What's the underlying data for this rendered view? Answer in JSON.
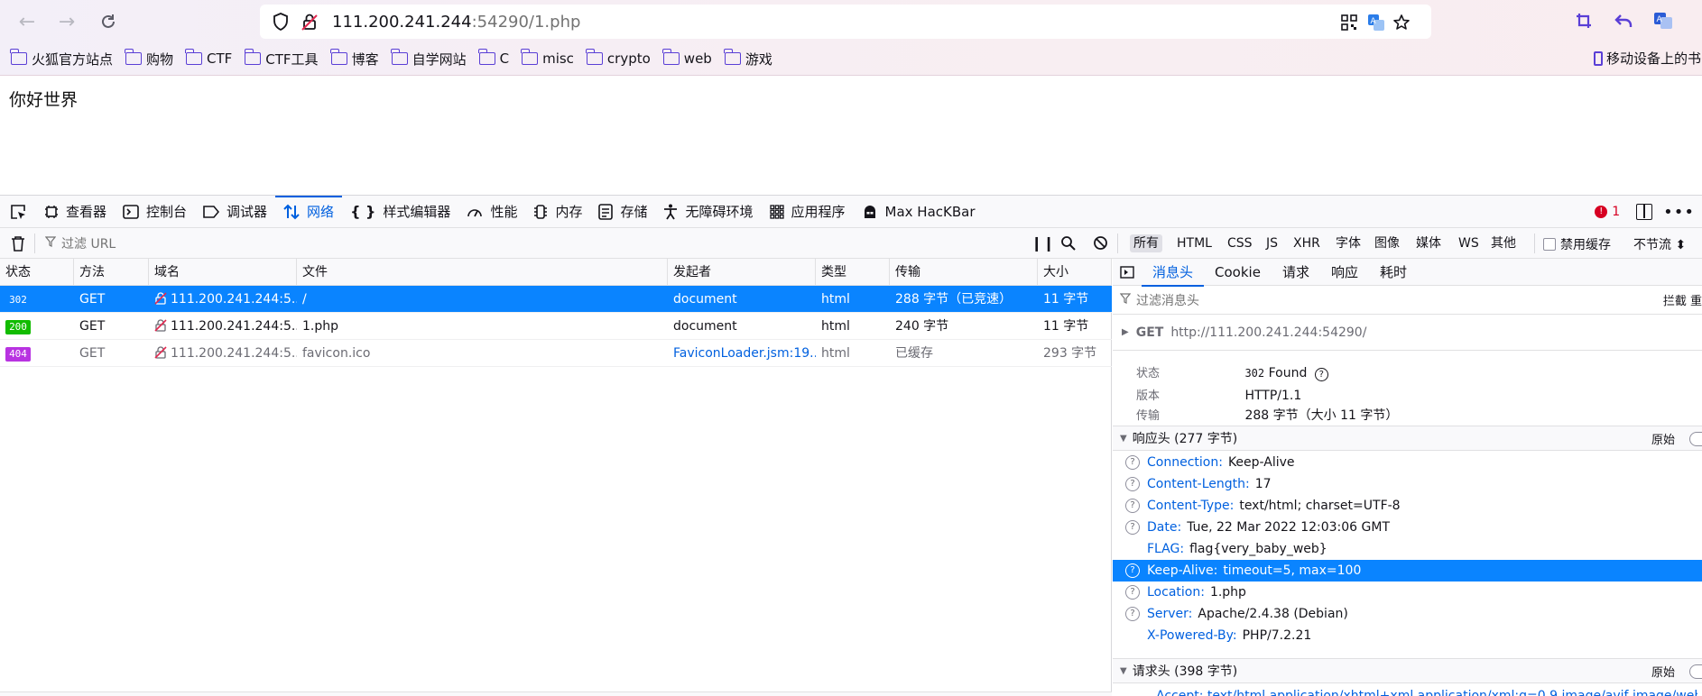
{
  "browser": {
    "url_host": "111.200.241.244",
    "url_rest": ":54290/1.php",
    "bookmarks": [
      "火狐官方站点",
      "购物",
      "CTF",
      "CTF工具",
      "博客",
      "自学网站",
      "C",
      "misc",
      "crypto",
      "web",
      "游戏"
    ],
    "mobile_bookmarks": "移动设备上的书"
  },
  "page": {
    "body_text": "你好世界"
  },
  "devtools": {
    "tabs": [
      {
        "label": "查看器",
        "icon": "inspector-icon"
      },
      {
        "label": "控制台",
        "icon": "console-icon"
      },
      {
        "label": "调试器",
        "icon": "debugger-icon"
      },
      {
        "label": "网络",
        "icon": "network-icon"
      },
      {
        "label": "样式编辑器",
        "icon": "style-editor-icon"
      },
      {
        "label": "性能",
        "icon": "performance-icon"
      },
      {
        "label": "内存",
        "icon": "memory-icon"
      },
      {
        "label": "存储",
        "icon": "storage-icon"
      },
      {
        "label": "无障碍环境",
        "icon": "accessibility-icon"
      },
      {
        "label": "应用程序",
        "icon": "application-icon"
      },
      {
        "label": "Max HacKBar",
        "icon": "hackbar-icon"
      }
    ],
    "error_count": "1",
    "filter_placeholder": "过滤 URL",
    "type_filters": [
      "所有",
      "HTML",
      "CSS",
      "JS",
      "XHR",
      "字体",
      "图像",
      "媒体",
      "WS",
      "其他"
    ],
    "disable_cache": "禁用缓存",
    "throttle": "不节流 ⬍",
    "columns": [
      "状态",
      "方法",
      "域名",
      "文件",
      "发起者",
      "类型",
      "传输",
      "大小"
    ],
    "requests": [
      {
        "status": "302",
        "method": "GET",
        "domain": "111.200.241.244:5...",
        "file": "/",
        "initiator": "document",
        "type": "html",
        "transferred": "288 字节（已竞速）",
        "size": "11 字节"
      },
      {
        "status": "200",
        "method": "GET",
        "domain": "111.200.241.244:5...",
        "file": "1.php",
        "initiator": "document",
        "type": "html",
        "transferred": "240 字节",
        "size": "11 字节"
      },
      {
        "status": "404",
        "method": "GET",
        "domain": "111.200.241.244:5...",
        "file": "favicon.ico",
        "initiator": "FaviconLoader.jsm:19...",
        "type": "html",
        "transferred": "已缓存",
        "size": "293 字节"
      }
    ],
    "side_tabs": [
      "消息头",
      "Cookie",
      "请求",
      "响应",
      "耗时"
    ],
    "header_filter_placeholder": "过滤消息头",
    "header_actions": "拦截  重",
    "request_method": "GET",
    "request_url": "http://111.200.241.244:54290/",
    "summary": {
      "status_label": "状态",
      "status_code": "302",
      "status_text": "Found",
      "version_label": "版本",
      "version": "HTTP/1.1",
      "transfer_label": "传输",
      "transfer": "288 字节（大小 11 字节）"
    },
    "response_headers_title": "响应头 (277 字节)",
    "raw_label": "原始",
    "response_headers": [
      {
        "name": "Connection:",
        "value": "Keep-Alive",
        "help": true
      },
      {
        "name": "Content-Length:",
        "value": "17",
        "help": true
      },
      {
        "name": "Content-Type:",
        "value": "text/html; charset=UTF-8",
        "help": true
      },
      {
        "name": "Date:",
        "value": "Tue, 22 Mar 2022 12:03:06 GMT",
        "help": true
      },
      {
        "name": "FLAG:",
        "value": "flag{very_baby_web}",
        "help": false
      },
      {
        "name": "Keep-Alive:",
        "value": "timeout=5, max=100",
        "help": true
      },
      {
        "name": "Location:",
        "value": "1.php",
        "help": true
      },
      {
        "name": "Server:",
        "value": "Apache/2.4.38 (Debian)",
        "help": true
      },
      {
        "name": "X-Powered-By:",
        "value": "PHP/7.2.21",
        "help": false
      }
    ],
    "request_headers_title": "请求头 (398 字节)",
    "partial_request_header": "Accept: text/html,application/xhtml+xml,application/xml;q=0.9,image/avif,image/webp,*/",
    "colors": {
      "accent": "#0060df",
      "selected": "#0a84ff",
      "status_302": "#0060df",
      "status_200": "#12bc00",
      "status_404": "#b833e1"
    }
  }
}
